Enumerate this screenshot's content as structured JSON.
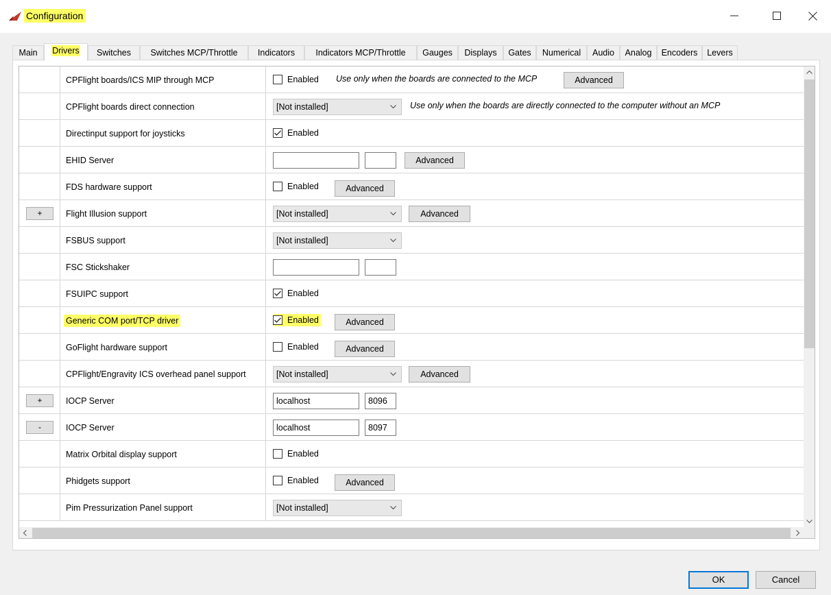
{
  "window": {
    "title": "Configuration",
    "app_icon": "red-arrow-plane-icon",
    "highlight_color": "#ffff66"
  },
  "tabs": [
    {
      "label": "Main",
      "active": false
    },
    {
      "label": "Drivers",
      "active": true
    },
    {
      "label": "Switches",
      "active": false
    },
    {
      "label": "Switches MCP/Throttle",
      "active": false
    },
    {
      "label": "Indicators",
      "active": false
    },
    {
      "label": "Indicators MCP/Throttle",
      "active": false
    },
    {
      "label": "Gauges",
      "active": false
    },
    {
      "label": "Displays",
      "active": false
    },
    {
      "label": "Gates",
      "active": false
    },
    {
      "label": "Numerical",
      "active": false
    },
    {
      "label": "Audio",
      "active": false
    },
    {
      "label": "Analog",
      "active": false
    },
    {
      "label": "Encoders",
      "active": false
    },
    {
      "label": "Levers",
      "active": false
    }
  ],
  "drivers": [
    {
      "name": "CPFlight boards/ICS MIP through MCP",
      "checkbox_label": "Enabled",
      "checked": false,
      "note": "Use only when the boards are connected to the MCP",
      "advanced": "Advanced"
    },
    {
      "name": "CPFlight boards direct connection",
      "dropdown": "[Not installed]",
      "note": "Use only when the boards are directly connected to the computer without an MCP"
    },
    {
      "name": "Directinput support for joysticks",
      "checkbox_label": "Enabled",
      "checked": true
    },
    {
      "name": "EHID Server",
      "text1": "",
      "text2": "",
      "advanced": "Advanced"
    },
    {
      "name": "FDS hardware support",
      "checkbox_label": "Enabled",
      "checked": false,
      "advanced": "Advanced"
    },
    {
      "name": "Flight Illusion support",
      "expand": "+",
      "dropdown": "[Not installed]",
      "advanced": "Advanced"
    },
    {
      "name": "FSBUS support",
      "dropdown": "[Not installed]"
    },
    {
      "name": "FSC Stickshaker",
      "text1": "",
      "text2": ""
    },
    {
      "name": "FSUIPC support",
      "checkbox_label": "Enabled",
      "checked": true
    },
    {
      "name": "Generic COM port/TCP driver",
      "checkbox_label": "Enabled",
      "checked": true,
      "advanced": "Advanced",
      "highlighted": true
    },
    {
      "name": "GoFlight hardware support",
      "checkbox_label": "Enabled",
      "checked": false,
      "advanced": "Advanced"
    },
    {
      "name": "CPFlight/Engravity ICS overhead panel support",
      "dropdown": "[Not installed]",
      "advanced": "Advanced"
    },
    {
      "name": "IOCP Server",
      "expand": "+",
      "text1": "localhost",
      "text2": "8096"
    },
    {
      "name": "IOCP Server",
      "expand": "-",
      "text1": "localhost",
      "text2": "8097"
    },
    {
      "name": "Matrix Orbital display support",
      "checkbox_label": "Enabled",
      "checked": false
    },
    {
      "name": "Phidgets support",
      "checkbox_label": "Enabled",
      "checked": false,
      "advanced": "Advanced"
    },
    {
      "name": "Pim Pressurization Panel support",
      "dropdown": "[Not installed]"
    }
  ],
  "footer": {
    "ok": "OK",
    "cancel": "Cancel"
  },
  "icons": {
    "minimize": "minimize-icon",
    "maximize": "maximize-icon",
    "close": "close-icon",
    "dropdown": "chevron-down-icon",
    "check": "checkmark-icon"
  }
}
